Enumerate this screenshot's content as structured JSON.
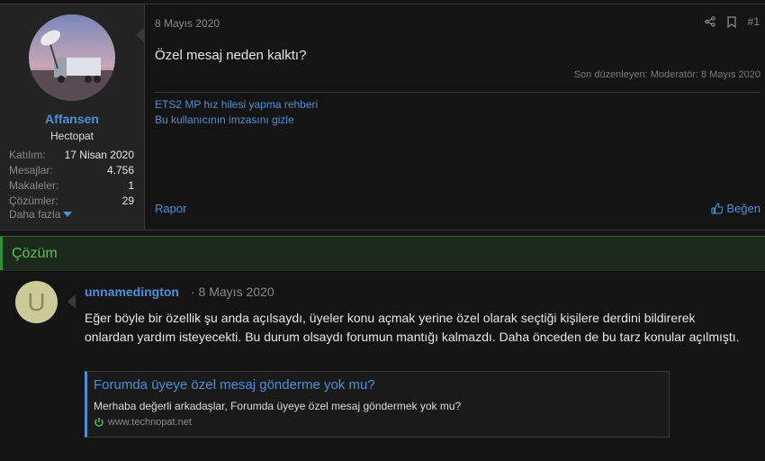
{
  "post1": {
    "user": {
      "name": "Affansen",
      "title": "Hectopat",
      "stats": [
        {
          "label": "Katılım:",
          "value": "17 Nisan 2020"
        },
        {
          "label": "Mesajlar:",
          "value": "4.756"
        },
        {
          "label": "Makaleler:",
          "value": "1"
        },
        {
          "label": "Çözümler:",
          "value": "29"
        }
      ],
      "more_label": "Daha fazla"
    },
    "date": "8 Mayıs 2020",
    "number": "#1",
    "body": "Özel mesaj neden kalktı?",
    "edited": "Son düzenleyen: Moderatör: 8 Mayıs 2020",
    "signature": [
      "ETS2 MP hız hilesi yapma rehberi",
      "Bu kullanıcının imzasını gizle"
    ],
    "report_label": "Rapor",
    "like_label": "Beğen"
  },
  "solution_label": "Çözüm",
  "post2": {
    "avatar_letter": "U",
    "author": "unnamedington",
    "date": "· 8 Mayıs 2020",
    "body": "Eğer böyle bir özellik şu anda açılsaydı, üyeler konu açmak yerine özel olarak seçtiği kişilere derdini bildirerek onlardan yardım isteyecekti. Bu durum olsaydı forumun mantığı kalmazdı. Daha önceden de bu tarz konular açılmıştı.",
    "unfurl": {
      "title": "Forumda üyeye özel mesaj gönderme yok mu?",
      "description": "Merhaba değerli arkadaşlar, Forumda üyeye özel mesaj göndermek yok mu?",
      "domain": "www.technopat.net"
    }
  },
  "colors": {
    "link": "#4a90d9",
    "solution": "#2f8f3a",
    "background": "#141414"
  }
}
